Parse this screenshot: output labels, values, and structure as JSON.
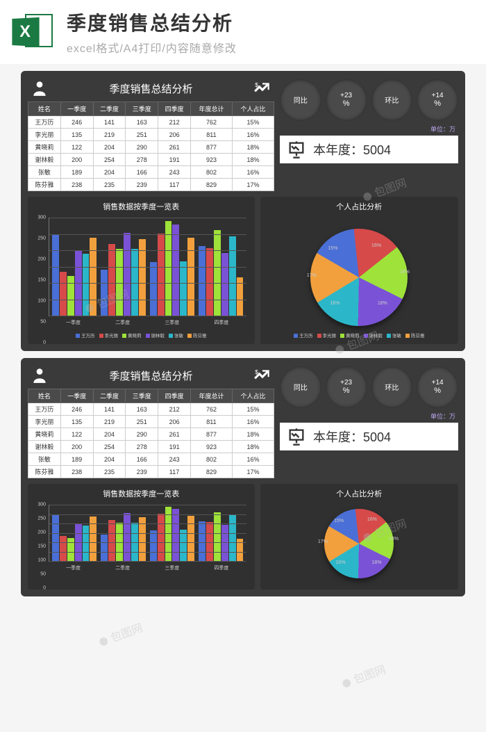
{
  "header": {
    "excel_letter": "X",
    "title": "季度销售总结分析",
    "subtitle": "excel格式/A4打印/内容随意修改"
  },
  "dashboard": {
    "title": "季度销售总结分析",
    "unit_label": "单位：万",
    "badges": [
      {
        "label": "同比",
        "value": ""
      },
      {
        "label": "+23",
        "value": "%"
      },
      {
        "label": "环比",
        "value": ""
      },
      {
        "label": "+14",
        "value": "%"
      }
    ],
    "year_label": "本年度：",
    "year_value": "5004"
  },
  "table": {
    "headers": [
      "姓名",
      "一季度",
      "二季度",
      "三季度",
      "四季度",
      "年度总计",
      "个人占比"
    ],
    "rows": [
      [
        "王万历",
        "246",
        "141",
        "163",
        "212",
        "762",
        "15%"
      ],
      [
        "李光丽",
        "135",
        "219",
        "251",
        "206",
        "811",
        "16%"
      ],
      [
        "黄晓莉",
        "122",
        "204",
        "290",
        "261",
        "877",
        "18%"
      ],
      [
        "谢林毅",
        "200",
        "254",
        "278",
        "191",
        "923",
        "18%"
      ],
      [
        "张敏",
        "189",
        "204",
        "166",
        "243",
        "802",
        "16%"
      ],
      [
        "陈芬雅",
        "238",
        "235",
        "239",
        "117",
        "829",
        "17%"
      ]
    ]
  },
  "chart_data": [
    {
      "type": "bar",
      "title": "销售数据按季度一览表",
      "categories": [
        "一季度",
        "二季度",
        "三季度",
        "四季度"
      ],
      "series": [
        {
          "name": "王万历",
          "values": [
            246,
            141,
            163,
            212
          ],
          "color": "#4a6fd6"
        },
        {
          "name": "李光丽",
          "values": [
            135,
            219,
            251,
            206
          ],
          "color": "#d64a4a"
        },
        {
          "name": "黄晓莉",
          "values": [
            122,
            204,
            290,
            261
          ],
          "color": "#9ee23a"
        },
        {
          "name": "谢林毅",
          "values": [
            200,
            254,
            278,
            191
          ],
          "color": "#7a52d6"
        },
        {
          "name": "张敏",
          "values": [
            189,
            204,
            166,
            243
          ],
          "color": "#2bb7c9"
        },
        {
          "name": "陈芬雅",
          "values": [
            238,
            235,
            239,
            117
          ],
          "color": "#f2a03d"
        }
      ],
      "ylim": [
        0,
        300
      ],
      "yticks": [
        0,
        50,
        100,
        150,
        200,
        250,
        300
      ],
      "xlabel": "",
      "ylabel": ""
    },
    {
      "type": "pie",
      "title": "个人占比分析",
      "series": [
        {
          "name": "王万历",
          "value": 15,
          "color": "#4a6fd6"
        },
        {
          "name": "李光丽",
          "value": 16,
          "color": "#d64a4a"
        },
        {
          "name": "黄晓莉",
          "value": 18,
          "color": "#9ee23a"
        },
        {
          "name": "谢林毅",
          "value": 18,
          "color": "#7a52d6"
        },
        {
          "name": "张敏",
          "value": 16,
          "color": "#2bb7c9"
        },
        {
          "name": "陈芬雅",
          "value": 17,
          "color": "#f2a03d"
        }
      ]
    }
  ],
  "watermark": "包图网"
}
